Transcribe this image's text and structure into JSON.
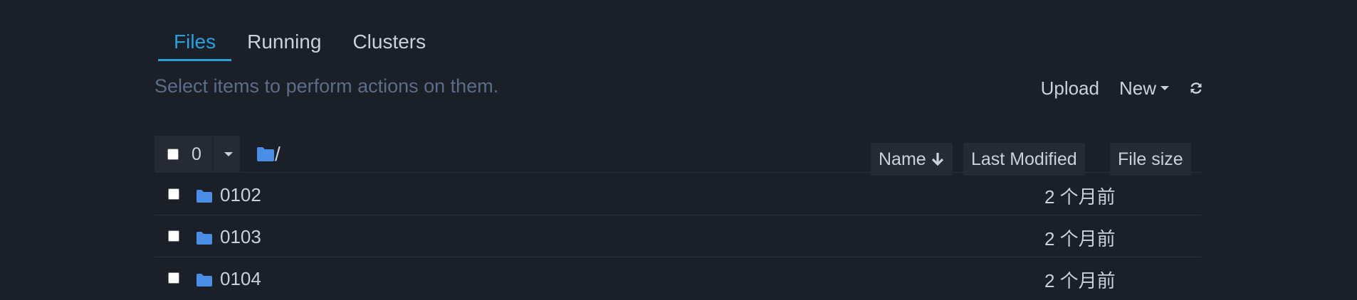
{
  "tabs": [
    {
      "label": "Files",
      "active": true
    },
    {
      "label": "Running",
      "active": false
    },
    {
      "label": "Clusters",
      "active": false
    }
  ],
  "toolbar": {
    "hint": "Select items to perform actions on them.",
    "upload_label": "Upload",
    "new_label": "New",
    "refresh_icon": "refresh-icon"
  },
  "list_header": {
    "selected_count": "0",
    "breadcrumb": "/",
    "sort_name_label": "Name",
    "sort_modified_label": "Last Modified",
    "sort_size_label": "File size"
  },
  "rows": [
    {
      "name": "0102",
      "modified": "2 个月前"
    },
    {
      "name": "0103",
      "modified": "2 个月前"
    },
    {
      "name": "0104",
      "modified": "2 个月前"
    }
  ],
  "colors": {
    "background": "#1b1f27",
    "accent": "#22a3e0",
    "folder": "#4a8ee8",
    "muted_text": "#5d6d89"
  }
}
